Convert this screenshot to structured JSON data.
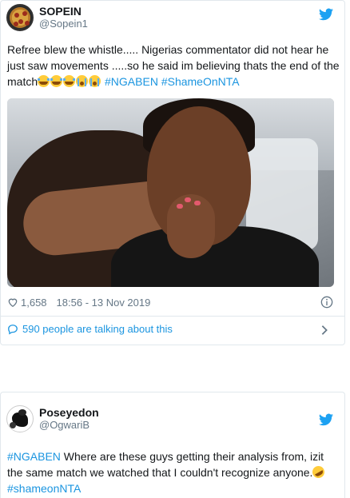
{
  "tweet1": {
    "display_name": "SOPEIN",
    "handle": "@Sopein1",
    "text_before_emoji": "Refree blew the whistle..... Nigerias commentator did not hear he just saw movements .....so he said im believing thats the end of the match",
    "hashtags": [
      "#NGABEN",
      "#ShameOnNTA"
    ],
    "likes": "1,658",
    "timestamp": "18:56 - 13 Nov 2019",
    "talking": "590 people are talking about this"
  },
  "tweet2": {
    "display_name": "Poseyedon",
    "handle": "@OgwariB",
    "hashtag_lead": "#NGABEN",
    "text": " Where are these  guys getting their  analysis from, izit the same match we watched that I couldn't  recognize anyone.",
    "hashtag_tail": "#shameonNTA"
  },
  "colors": {
    "link": "#1b95e0",
    "twitter_blue": "#1da1f2",
    "muted": "#657786",
    "text": "#14171a"
  },
  "icons": {
    "brand": "twitter-bird-icon",
    "like": "heart-icon",
    "info": "info-icon",
    "conversation": "speech-bubble-icon",
    "more": "chevron-right-icon"
  }
}
